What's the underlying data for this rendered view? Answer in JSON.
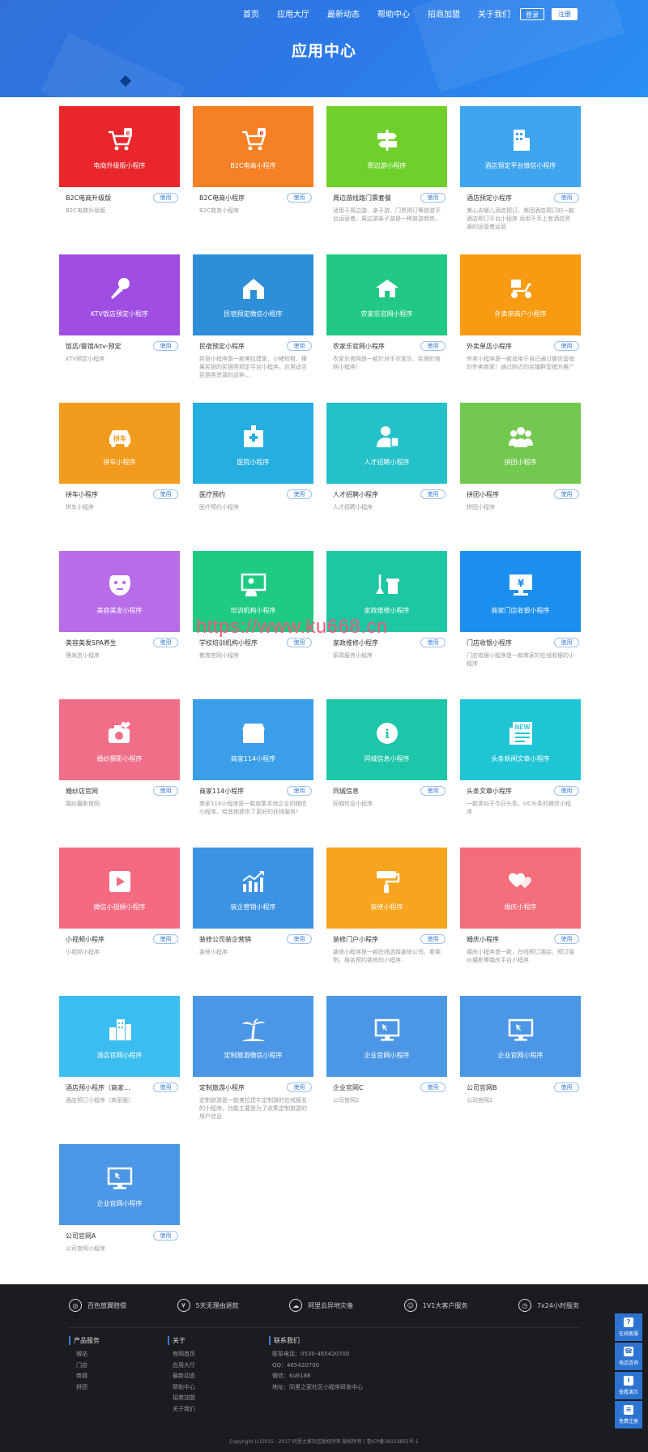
{
  "nav": {
    "items": [
      "首页",
      "应用大厅",
      "最新动态",
      "帮助中心",
      "招商加盟",
      "关于我们"
    ],
    "login": "登录",
    "register": "注册"
  },
  "page_title": "应用中心",
  "use_label": "使用",
  "apps": [
    {
      "tile": "电商升级版小程序",
      "title": "B2C电商升级版",
      "desc": "B2C电商升级版",
      "color": "#e8262b",
      "icon": "cart-e-icon"
    },
    {
      "tile": "B2C电商小程序",
      "title": "B2C电商小程序",
      "desc": "B2C商务小程序",
      "color": "#f58025",
      "icon": "cart-e-icon"
    },
    {
      "tile": "周边游小程序",
      "title": "周边游线路门票套餐",
      "desc": "适用于周边游、亲子游、门票预订等旅游平台运营者，周边游亲子游是一种旅游趋势。",
      "color": "#6fd02c",
      "icon": "signpost-icon"
    },
    {
      "tile": "酒店预定平台微信小程序",
      "title": "酒店预定小程序",
      "desc": "美心去哪儿酒店预订、美团酒店预订的一款酒店预订平台小程序 适用于手上有酒店资源的运营者运营",
      "color": "#3ea5ee",
      "icon": "hotel-icon"
    },
    {
      "tile": "KTV饭店预定小程序",
      "title": "饭店/餐馆/ktv-预定",
      "desc": "KTV预定小程序",
      "color": "#a04de3",
      "icon": "microphone-icon"
    },
    {
      "tile": "民宿预定微信小程序",
      "title": "民宿预定小程序",
      "desc": "民宿小程序是一款美拉建家、小猪短租、榛果民宿的民宿类预定平台小程序，应用适合民宿类资源的这种...",
      "color": "#2e8fd8",
      "icon": "house-icon"
    },
    {
      "tile": "农家乐官网小程序",
      "title": "农家乐官网小程序",
      "desc": "农家乐官网是一款针对于农家乐、民宿的官网小程序！",
      "color": "#21c984",
      "icon": "farm-icon"
    },
    {
      "tile": "外卖单商户小程序",
      "title": "外卖单店小程序",
      "desc": "外卖小程序是一款适用于自己通过微信营销的外卖商家！通过附近的店铺群营销为推广",
      "color": "#f99b12",
      "icon": "scooter-icon"
    },
    {
      "tile": "拼车小程序",
      "title": "拼车小程序",
      "desc": "拼车小程序",
      "color": "#f19c1c",
      "icon": "car-icon"
    },
    {
      "tile": "医院小程序",
      "title": "医疗预约",
      "desc": "医疗预约小程序",
      "color": "#25aee0",
      "icon": "hospital-icon"
    },
    {
      "tile": "人才招聘小程序",
      "title": "人才招聘小程序",
      "desc": "人才招聘小程序",
      "color": "#25c1c9",
      "icon": "recruit-icon"
    },
    {
      "tile": "拼团小程序",
      "title": "拼团小程序",
      "desc": "拼团小程序",
      "color": "#73c84f",
      "icon": "group-icon"
    },
    {
      "tile": "美容美发小程序",
      "title": "美容美发SPA养生",
      "desc": "理发店小程序",
      "color": "#b76ce8",
      "icon": "mask-icon"
    },
    {
      "tile": "培训机构小程序",
      "title": "学校培训机构小程序",
      "desc": "教育官网小程序",
      "color": "#1fca82",
      "icon": "teacher-icon"
    },
    {
      "tile": "家政维修小程序",
      "title": "家政维修小程序",
      "desc": "家政服务小程序",
      "color": "#1dc7a3",
      "icon": "cleaning-icon"
    },
    {
      "tile": "商家门店收银小程序",
      "title": "门店收银小程序",
      "desc": "门店收银小程序是一款商家的在线收银的小程序",
      "color": "#1b8fee",
      "icon": "cashier-icon"
    },
    {
      "tile": "婚纱摄影小程序",
      "title": "婚纱店官网",
      "desc": "婚纱摄影官网",
      "color": "#f06e88",
      "icon": "camera-icon"
    },
    {
      "tile": "商家114小程序",
      "title": "商家114小程序",
      "desc": "商家114小程序是一款收集本地企业的微信小程序，给其他提供了更好的在线服务！",
      "color": "#3a9ee8",
      "icon": "store-icon"
    },
    {
      "tile": "同城信息小程序",
      "title": "同城信息",
      "desc": "同城信息小程序",
      "color": "#1dc6a9",
      "icon": "info-icon"
    },
    {
      "tile": "头条新闻文章小程序",
      "title": "头条文章小程序",
      "desc": "一款类似于今日头条、UC头条的微信小程序",
      "color": "#1fc5d5",
      "icon": "news-icon"
    },
    {
      "tile": "微信小视频小程序",
      "title": "小视频小程序",
      "desc": "小视频小程序",
      "color": "#f46b81",
      "icon": "video-icon"
    },
    {
      "tile": "装企营销小程序",
      "title": "装修公司装企营销",
      "desc": "装修小程序",
      "color": "#3c92e3",
      "icon": "chart-up-icon"
    },
    {
      "tile": "装修小程序",
      "title": "装修门户小程序",
      "desc": "装修小程序是一款在线选择装修公司、看案例，报名预约装修的小程序",
      "color": "#f7a41e",
      "icon": "paint-roller-icon"
    },
    {
      "tile": "婚庆小程序",
      "title": "婚庆小程序",
      "desc": "婚庆小程序是一款，在线预订酒店、预订婚纱摄影等婚庆平台小程序",
      "color": "#f46d7a",
      "icon": "hearts-icon"
    },
    {
      "tile": "酒店官网小程序",
      "title": "酒店预小程序（商家...",
      "desc": "酒店预订小程序（商家版）",
      "color": "#3bbdef",
      "icon": "buildings-icon"
    },
    {
      "tile": "定制旅游微信小程序",
      "title": "定制旅游小程序",
      "desc": "定制旅游是一款美拉建牛定制游的在线报名的小程序，功能主要是为了收集定制旅游的用户信息",
      "color": "#4c97e5",
      "icon": "palm-icon"
    },
    {
      "tile": "企业官网小程序",
      "title": "企业官网C",
      "desc": "公司官网2",
      "color": "#4c97e5",
      "icon": "monitor-icon"
    },
    {
      "tile": "企业官网小程序",
      "title": "公司官网B",
      "desc": "公司官网2",
      "color": "#4c97e5",
      "icon": "monitor-icon"
    },
    {
      "tile": "企业官网小程序",
      "title": "公司官网A",
      "desc": "公司官网小程序",
      "color": "#4c97e5",
      "icon": "monitor-icon"
    }
  ],
  "watermark": "https://www.ku668.cn",
  "footer": {
    "guarantees": [
      {
        "icon": "medal-icon",
        "label": "百色放翼赔偿"
      },
      {
        "icon": "yen-icon",
        "label": "5天无理由退款"
      },
      {
        "icon": "cloud-icon",
        "label": "阿里云异地灾备"
      },
      {
        "icon": "service-icon",
        "label": "1V1大客户服务"
      },
      {
        "icon": "clock-icon",
        "label": "7x24小时服务"
      }
    ],
    "products": {
      "heading": "产品服务",
      "links": [
        "微站",
        "门店",
        "商城",
        "拼团"
      ]
    },
    "about": {
      "heading": "关于",
      "links": [
        "官网首页",
        "应用大厅",
        "最新动态",
        "帮助中心",
        "招商加盟",
        "关于我们"
      ]
    },
    "contact": {
      "heading": "联系我们",
      "links": [
        "联系电话：0530-465420700",
        "QQ：465420700",
        "微信：Ku6188",
        "地址：同里之家社区小程序研发中心"
      ]
    },
    "copyright": "Copyright (c)2015 - 2017 同里之家社区版权所有 版权所有 | 鲁ICP备16033855号-1"
  },
  "float_bar": [
    {
      "icon": "question-icon",
      "glyph": "?",
      "label": "在线客服"
    },
    {
      "icon": "phone-icon",
      "glyph": "☎",
      "label": "电话咨询"
    },
    {
      "icon": "info-icon",
      "glyph": "i",
      "label": "查看演示"
    },
    {
      "icon": "document-icon",
      "glyph": "≡",
      "label": "免费注册"
    }
  ]
}
